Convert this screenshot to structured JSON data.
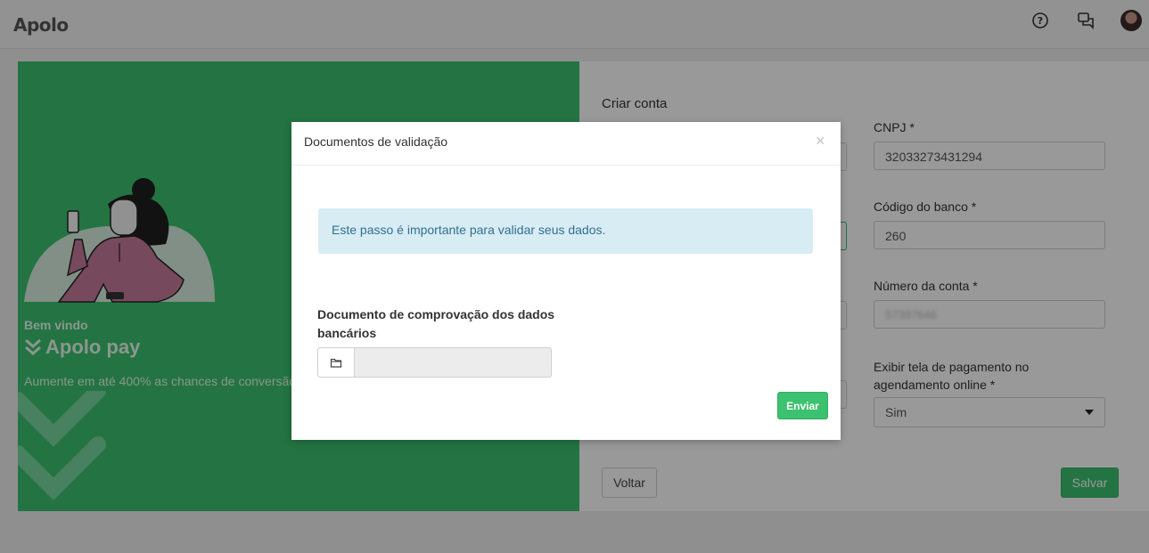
{
  "app": {
    "brand": "Apolo"
  },
  "header": {
    "icons": [
      "help-circle-icon",
      "chat-icon",
      "user-avatar"
    ]
  },
  "promo": {
    "welcome": "Bem vindo",
    "product": "Apolo pay",
    "tagline": "Aumente em até 400% as chances de conversão"
  },
  "form": {
    "title": "Criar conta",
    "cnpj_label": "CNPJ *",
    "cnpj_value": "32033273431294",
    "bank_code_label": "Código do banco *",
    "bank_code_value": "260",
    "account_number_label": "Número da conta *",
    "account_number_value": "57397646",
    "show_payment_label": "Exibir tela de pagamento no agendamento online *",
    "show_payment_value": "Sim",
    "back_label": "Voltar",
    "save_label": "Salvar"
  },
  "modal": {
    "title": "Documentos de validação",
    "close": "×",
    "info": "Este passo é importante para validar seus dados.",
    "doc_label": "Documento de comprovação dos dados bancários",
    "submit_label": "Enviar"
  },
  "colors": {
    "brand_green": "#3bc16f",
    "info_bg": "#d8ecf4",
    "info_text": "#31708f"
  }
}
